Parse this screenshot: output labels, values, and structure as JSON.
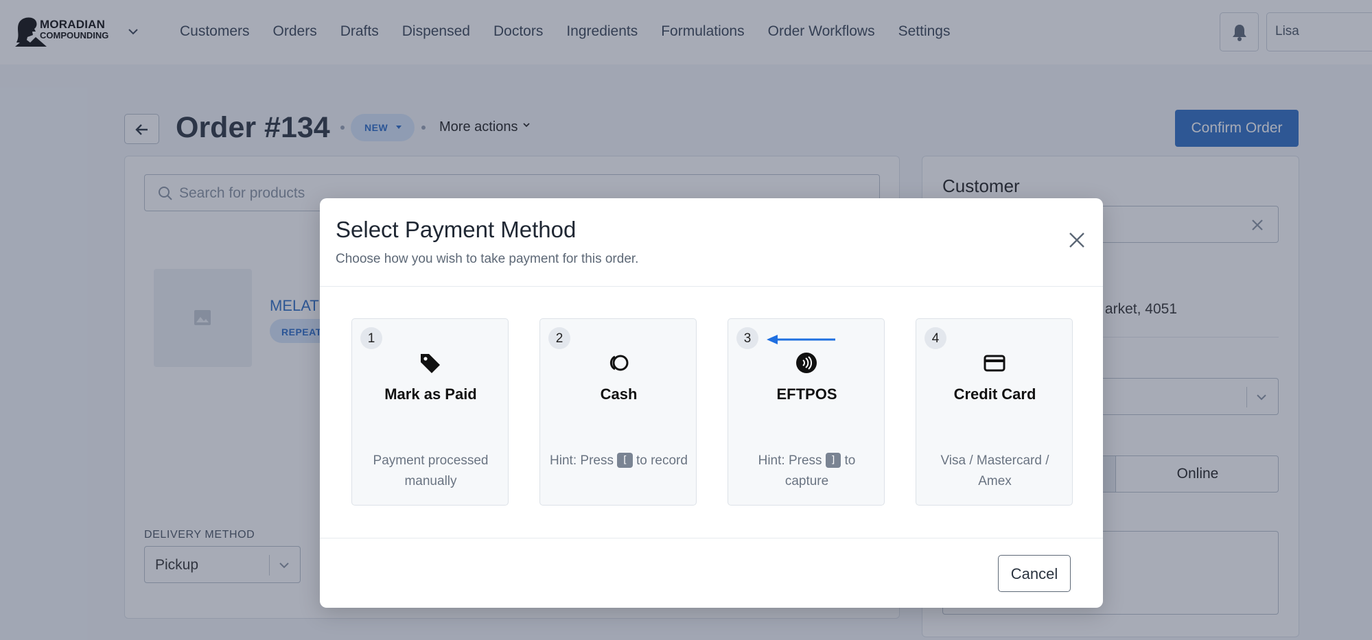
{
  "brand": {
    "line1": "MORADIAN",
    "line2": "COMPOUNDING"
  },
  "nav": {
    "items": [
      "Customers",
      "Orders",
      "Drafts",
      "Dispensed",
      "Doctors",
      "Ingredients",
      "Formulations",
      "Order Workflows",
      "Settings"
    ],
    "user": "Lisa"
  },
  "order": {
    "title": "Order #134",
    "status": "NEW",
    "more_actions": "More actions",
    "confirm_label": "Confirm Order"
  },
  "products": {
    "search_placeholder": "Search for products",
    "item_name": "MELAT",
    "item_tag": "REPEAT"
  },
  "delivery": {
    "label": "DELIVERY METHOD",
    "value": "Pickup"
  },
  "customer": {
    "title": "Customer",
    "address_fragment": "arket, 4051",
    "channel_online": "Online"
  },
  "modal": {
    "title": "Select Payment Method",
    "subtitle": "Choose how you wish to take payment for this order.",
    "methods": [
      {
        "num": "1",
        "label": "Mark as Paid",
        "icon": "tag-icon",
        "hint_pre": "Payment processed manually",
        "key": "",
        "hint_post": ""
      },
      {
        "num": "2",
        "label": "Cash",
        "icon": "coins-icon",
        "hint_pre": "Hint: Press",
        "key": "[",
        "hint_post": "to record"
      },
      {
        "num": "3",
        "label": "EFTPOS",
        "icon": "contactless-icon",
        "hint_pre": "Hint: Press",
        "key": "]",
        "hint_post": "to capture"
      },
      {
        "num": "4",
        "label": "Credit Card",
        "icon": "credit-card-icon",
        "hint_pre": "Visa / Mastercard / Amex",
        "key": "",
        "hint_post": ""
      }
    ],
    "cancel_label": "Cancel"
  },
  "colors": {
    "primary": "#2f6fc5",
    "annotation_arrow": "#1f6fe0",
    "overlay": "#2d3852"
  }
}
